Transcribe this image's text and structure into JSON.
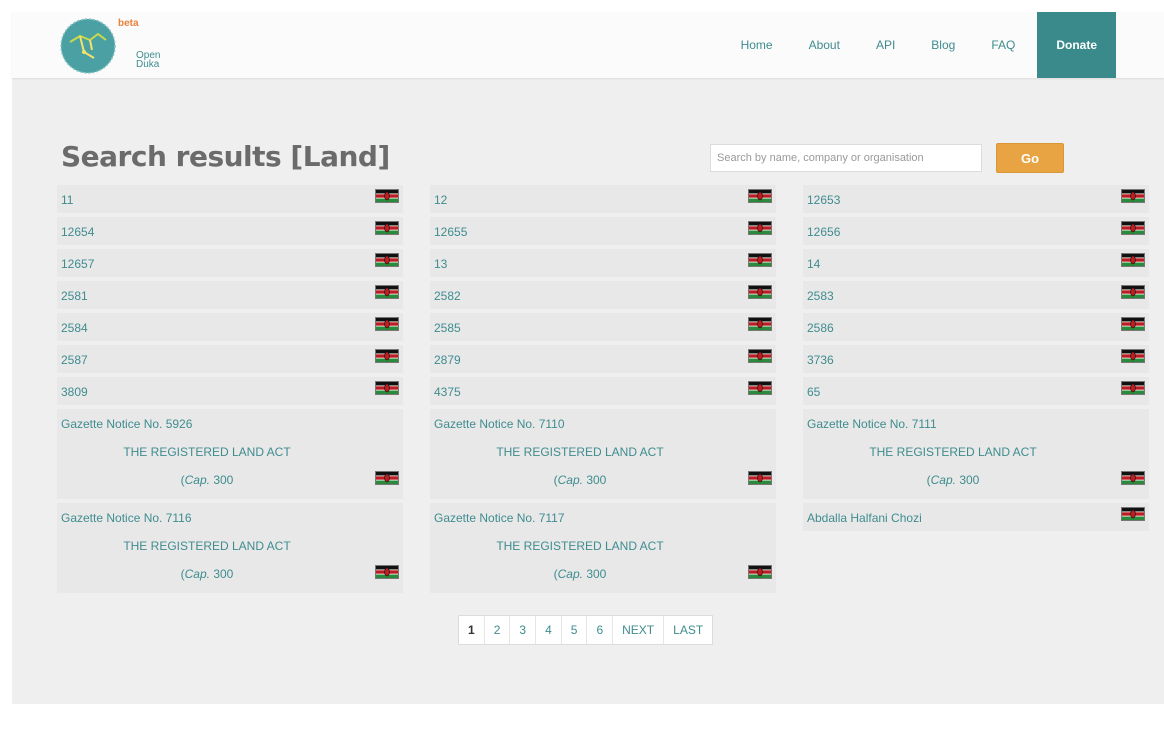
{
  "brand": {
    "beta_label": "beta",
    "line1": "Open",
    "line2": "Duka",
    "colors": {
      "teal": "#3a8a8c",
      "orange": "#e8a442"
    }
  },
  "nav": {
    "items": [
      "Home",
      "About",
      "API",
      "Blog",
      "FAQ"
    ],
    "donate": "Donate"
  },
  "page_title": "Search results [Land]",
  "search": {
    "placeholder": "Search by name, company or organisation",
    "go_label": "Go"
  },
  "results": {
    "columns": [
      [
        {
          "name": "11"
        },
        {
          "name": "12654"
        },
        {
          "name": "12657"
        },
        {
          "name": "2581"
        },
        {
          "name": "2584"
        },
        {
          "name": "2587"
        },
        {
          "name": "3809"
        },
        {
          "name": "Gazette Notice No. 5926",
          "line2": "THE REGISTERED LAND ACT",
          "line3a": "(",
          "line3b": "Cap.",
          "line3c": " 300"
        },
        {
          "name": "Gazette Notice No. 7116",
          "line2": "THE REGISTERED LAND ACT",
          "line3a": "(",
          "line3b": "Cap.",
          "line3c": " 300"
        }
      ],
      [
        {
          "name": "12"
        },
        {
          "name": "12655"
        },
        {
          "name": "13"
        },
        {
          "name": "2582"
        },
        {
          "name": "2585"
        },
        {
          "name": "2879"
        },
        {
          "name": "4375"
        },
        {
          "name": "Gazette Notice No. 7110",
          "line2": "THE REGISTERED LAND ACT",
          "line3a": "(",
          "line3b": "Cap.",
          "line3c": " 300"
        },
        {
          "name": "Gazette Notice No. 7117",
          "line2": "THE REGISTERED LAND ACT",
          "line3a": "(",
          "line3b": "Cap.",
          "line3c": " 300"
        }
      ],
      [
        {
          "name": "12653"
        },
        {
          "name": "12656"
        },
        {
          "name": "14"
        },
        {
          "name": "2583"
        },
        {
          "name": "2586"
        },
        {
          "name": "3736"
        },
        {
          "name": "65"
        },
        {
          "name": "Gazette Notice No. 7111",
          "line2": "THE REGISTERED LAND ACT",
          "line3a": "(",
          "line3b": "Cap.",
          "line3c": " 300"
        },
        {
          "name": "Abdalla Halfani Chozi"
        }
      ]
    ],
    "flag_icon": "kenya-flag-icon"
  },
  "pagination": {
    "pages": [
      "1",
      "2",
      "3",
      "4",
      "5",
      "6"
    ],
    "next": "NEXT",
    "last": "LAST",
    "current": "1"
  }
}
